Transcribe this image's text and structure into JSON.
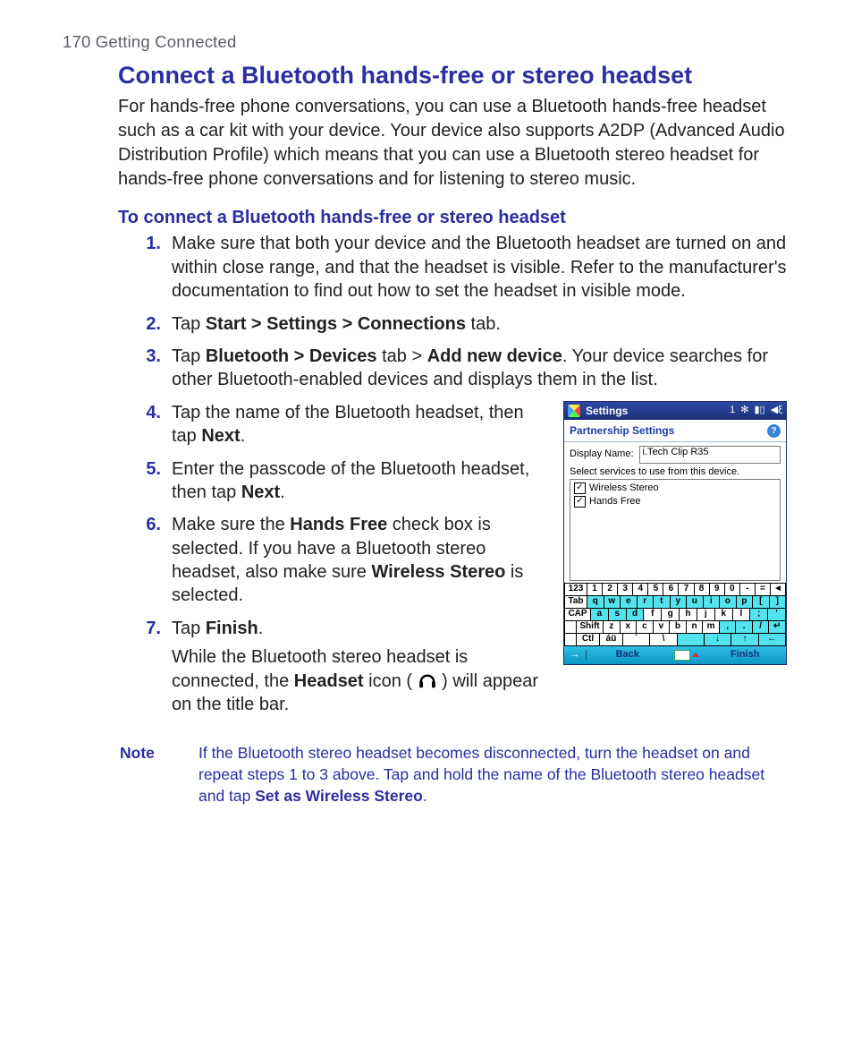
{
  "running_head": "170  Getting Connected",
  "h1": "Connect a Bluetooth hands-free or stereo headset",
  "intro": "For hands-free phone conversations, you can use a Bluetooth hands-free headset such as a car kit with your device. Your device also supports A2DP (Advanced Audio Distribution Profile) which means that you can use a Bluetooth stereo headset for hands-free phone conversations and for listening to stereo music.",
  "sub": "To connect a Bluetooth hands-free or stereo headset",
  "steps": {
    "s1": "Make sure that both your device and the Bluetooth headset are turned on and within close range, and that the headset is visible. Refer to the manufacturer's documentation to find out how to set the headset in visible mode.",
    "s2_pre": "Tap ",
    "s2_b": "Start > Settings > Connections",
    "s2_post": " tab.",
    "s3_pre": "Tap ",
    "s3_b1": "Bluetooth > Devices",
    "s3_mid": " tab > ",
    "s3_b2": "Add new device",
    "s3_post": ". Your device searches for other Bluetooth-enabled devices and displays them in the list.",
    "s4_pre": "Tap the name of the Bluetooth headset, then tap ",
    "s4_b": "Next",
    "s4_post": ".",
    "s5_pre": "Enter the passcode of the Bluetooth headset, then tap ",
    "s5_b": "Next",
    "s5_post": ".",
    "s6_pre": "Make sure the ",
    "s6_b1": "Hands Free",
    "s6_mid": " check box is selected. If you have a Bluetooth stereo headset, also make sure ",
    "s6_b2": "Wireless Stereo",
    "s6_post": " is selected.",
    "s7_pre": "Tap ",
    "s7_b": "Finish",
    "s7_post": ".",
    "s7x_pre": "While the Bluetooth stereo headset is connected, the ",
    "s7x_b": "Headset",
    "s7x_mid": " icon ( ",
    "s7x_post": " ) will appear on the title bar."
  },
  "note": {
    "label": "Note",
    "body_pre": "If the Bluetooth stereo headset becomes disconnected, turn the headset on and repeat steps 1 to 3 above. Tap and hold the name of the Bluetooth stereo headset and tap ",
    "body_b": "Set as Wireless Stereo",
    "body_post": "."
  },
  "device": {
    "titlebar": {
      "title": "Settings",
      "tray_left": "1",
      "tray_icons": [
        "bt-icon",
        "signal-icon",
        "speaker-icon"
      ]
    },
    "subtitle": "Partnership Settings",
    "display_name_label": "Display Name:",
    "display_name_value": "i.Tech Clip R35",
    "services_caption": "Select services to use from this device.",
    "services": [
      "Wireless Stereo",
      "Hands Free"
    ],
    "kbd": {
      "r1": [
        "123",
        "1",
        "2",
        "3",
        "4",
        "5",
        "6",
        "7",
        "8",
        "9",
        "0",
        "-",
        "="
      ],
      "r2": [
        "Tab",
        "q",
        "w",
        "e",
        "r",
        "t",
        "y",
        "u",
        "i",
        "o",
        "p",
        "[",
        "]"
      ],
      "r3": [
        "CAP",
        "a",
        "s",
        "d",
        "f",
        "g",
        "h",
        "j",
        "k",
        "l",
        ";",
        "'"
      ],
      "r4": [
        "Shift",
        "z",
        "x",
        "c",
        "v",
        "b",
        "n",
        "m",
        ",",
        ".",
        "/"
      ],
      "r5": [
        "Ctl",
        "áü",
        "`",
        "\\",
        " ",
        "↓",
        "↑",
        "←"
      ]
    },
    "softkeys": {
      "left": "Back",
      "right": "Finish"
    }
  }
}
